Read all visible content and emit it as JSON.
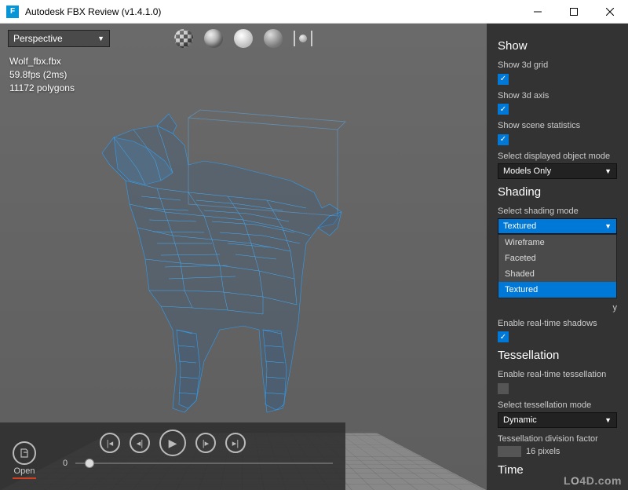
{
  "window": {
    "title": "Autodesk FBX Review (v1.4.1.0)",
    "app_icon_letter": "F"
  },
  "viewport": {
    "camera_mode": "Perspective",
    "stats": {
      "filename": "Wolf_fbx.fbx",
      "fps_line": "59.8fps (2ms)",
      "poly_line": "11172 polygons"
    }
  },
  "top_tools": {
    "checker": "texture-checker-icon",
    "lines": "wireframe-sphere-icon",
    "bulb": "lighting-icon",
    "plain": "shaded-sphere-icon",
    "frame": "frame-selection-icon"
  },
  "sidebar": {
    "show": {
      "heading": "Show",
      "grid_label": "Show 3d grid",
      "grid_checked": true,
      "axis_label": "Show 3d axis",
      "axis_checked": true,
      "stats_label": "Show scene statistics",
      "stats_checked": true,
      "object_mode_label": "Select displayed object mode",
      "object_mode_value": "Models Only"
    },
    "shading": {
      "heading": "Shading",
      "mode_label": "Select shading mode",
      "mode_value": "Textured",
      "mode_options": [
        "Wireframe",
        "Faceted",
        "Shaded",
        "Textured"
      ],
      "wireframe_overlay_label_partial": "y",
      "shadows_label": "Enable real-time shadows",
      "shadows_checked": true
    },
    "tessellation": {
      "heading": "Tessellation",
      "enable_label": "Enable real-time tessellation",
      "enable_checked": false,
      "mode_label": "Select tessellation mode",
      "mode_value": "Dynamic",
      "division_label": "Tessellation division factor",
      "division_value": "16 pixels"
    },
    "time": {
      "heading": "Time"
    }
  },
  "bottombar": {
    "open_label": "Open",
    "frame_value": "0"
  },
  "watermark": "LO4D.com"
}
